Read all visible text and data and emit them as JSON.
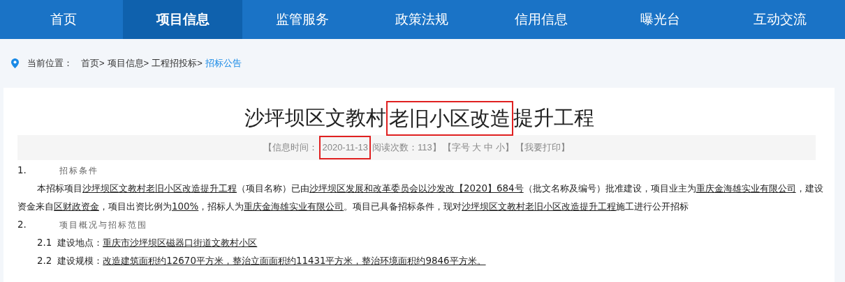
{
  "nav": [
    {
      "label": "首页",
      "selected": false
    },
    {
      "label": "项目信息",
      "selected": true
    },
    {
      "label": "监管服务",
      "selected": false
    },
    {
      "label": "政策法规",
      "selected": false
    },
    {
      "label": "信用信息",
      "selected": false
    },
    {
      "label": "曝光台",
      "selected": false
    },
    {
      "label": "互动交流",
      "selected": false
    }
  ],
  "breadcrumb": {
    "label": "当前位置：",
    "items": [
      {
        "text": "首页>",
        "current": false
      },
      {
        "text": "项目信息>",
        "current": false
      },
      {
        "text": "工程招投标>",
        "current": false
      },
      {
        "text": "招标公告",
        "current": true
      }
    ]
  },
  "article": {
    "title": [
      {
        "text": "沙坪坝区文教村",
        "highlighted": false
      },
      {
        "text": "老旧小区改造",
        "highlighted": true
      },
      {
        "text": "提升工程",
        "highlighted": false
      }
    ],
    "meta": [
      {
        "text": "【信息时间：",
        "highlighted": false
      },
      {
        "text": "2020-11-13",
        "highlighted": true
      },
      {
        "text": "阅读次数：113】",
        "highlighted": false
      },
      {
        "text": "【字号 大 中 小】",
        "highlighted": false
      },
      {
        "text": "【我要打印】",
        "highlighted": false
      }
    ],
    "body": [
      {
        "kind": "heading",
        "number": "1.",
        "text": "招标条件"
      },
      {
        "kind": "paragraph",
        "segments": [
          {
            "text": "本招标项目",
            "underlined": false
          },
          {
            "text": "沙坪坝区文教村老旧小区改造提升工程",
            "underlined": true
          },
          {
            "text": "（项目名称）已由",
            "underlined": false
          },
          {
            "text": "沙坪坝区发展和改革委员会以沙发改【2020】684号",
            "underlined": true
          },
          {
            "text": "（批文名称及编号）批准建设，项目业主为",
            "underlined": false
          },
          {
            "text": "重庆金海雄实业有限公司",
            "underlined": true
          },
          {
            "text": "，建设资金来自",
            "underlined": false
          },
          {
            "text": "区财政资金",
            "underlined": true
          },
          {
            "text": "，项目出资比例为",
            "underlined": false
          },
          {
            "text": "100%",
            "underlined": true
          },
          {
            "text": "，招标人为",
            "underlined": false
          },
          {
            "text": "重庆金海雄实业有限公司",
            "underlined": true
          },
          {
            "text": "。项目已具备招标条件，现对",
            "underlined": false
          },
          {
            "text": "沙坪坝区文教村老旧小区改造提升工程",
            "underlined": true
          },
          {
            "text": "施工进行公开招标",
            "underlined": false
          }
        ]
      },
      {
        "kind": "heading",
        "number": "2.",
        "text": "项目概况与招标范围"
      },
      {
        "kind": "item",
        "number": "2.1",
        "label": "建设地点：",
        "value": "重庆市沙坪坝区磁器口街道文教村小区"
      },
      {
        "kind": "item",
        "number": "2.2",
        "label": "建设规模：",
        "value": "改造建筑面积约12670平方米，整治立面面积约11431平方米，整治环境面积约9846平方米。"
      }
    ]
  }
}
